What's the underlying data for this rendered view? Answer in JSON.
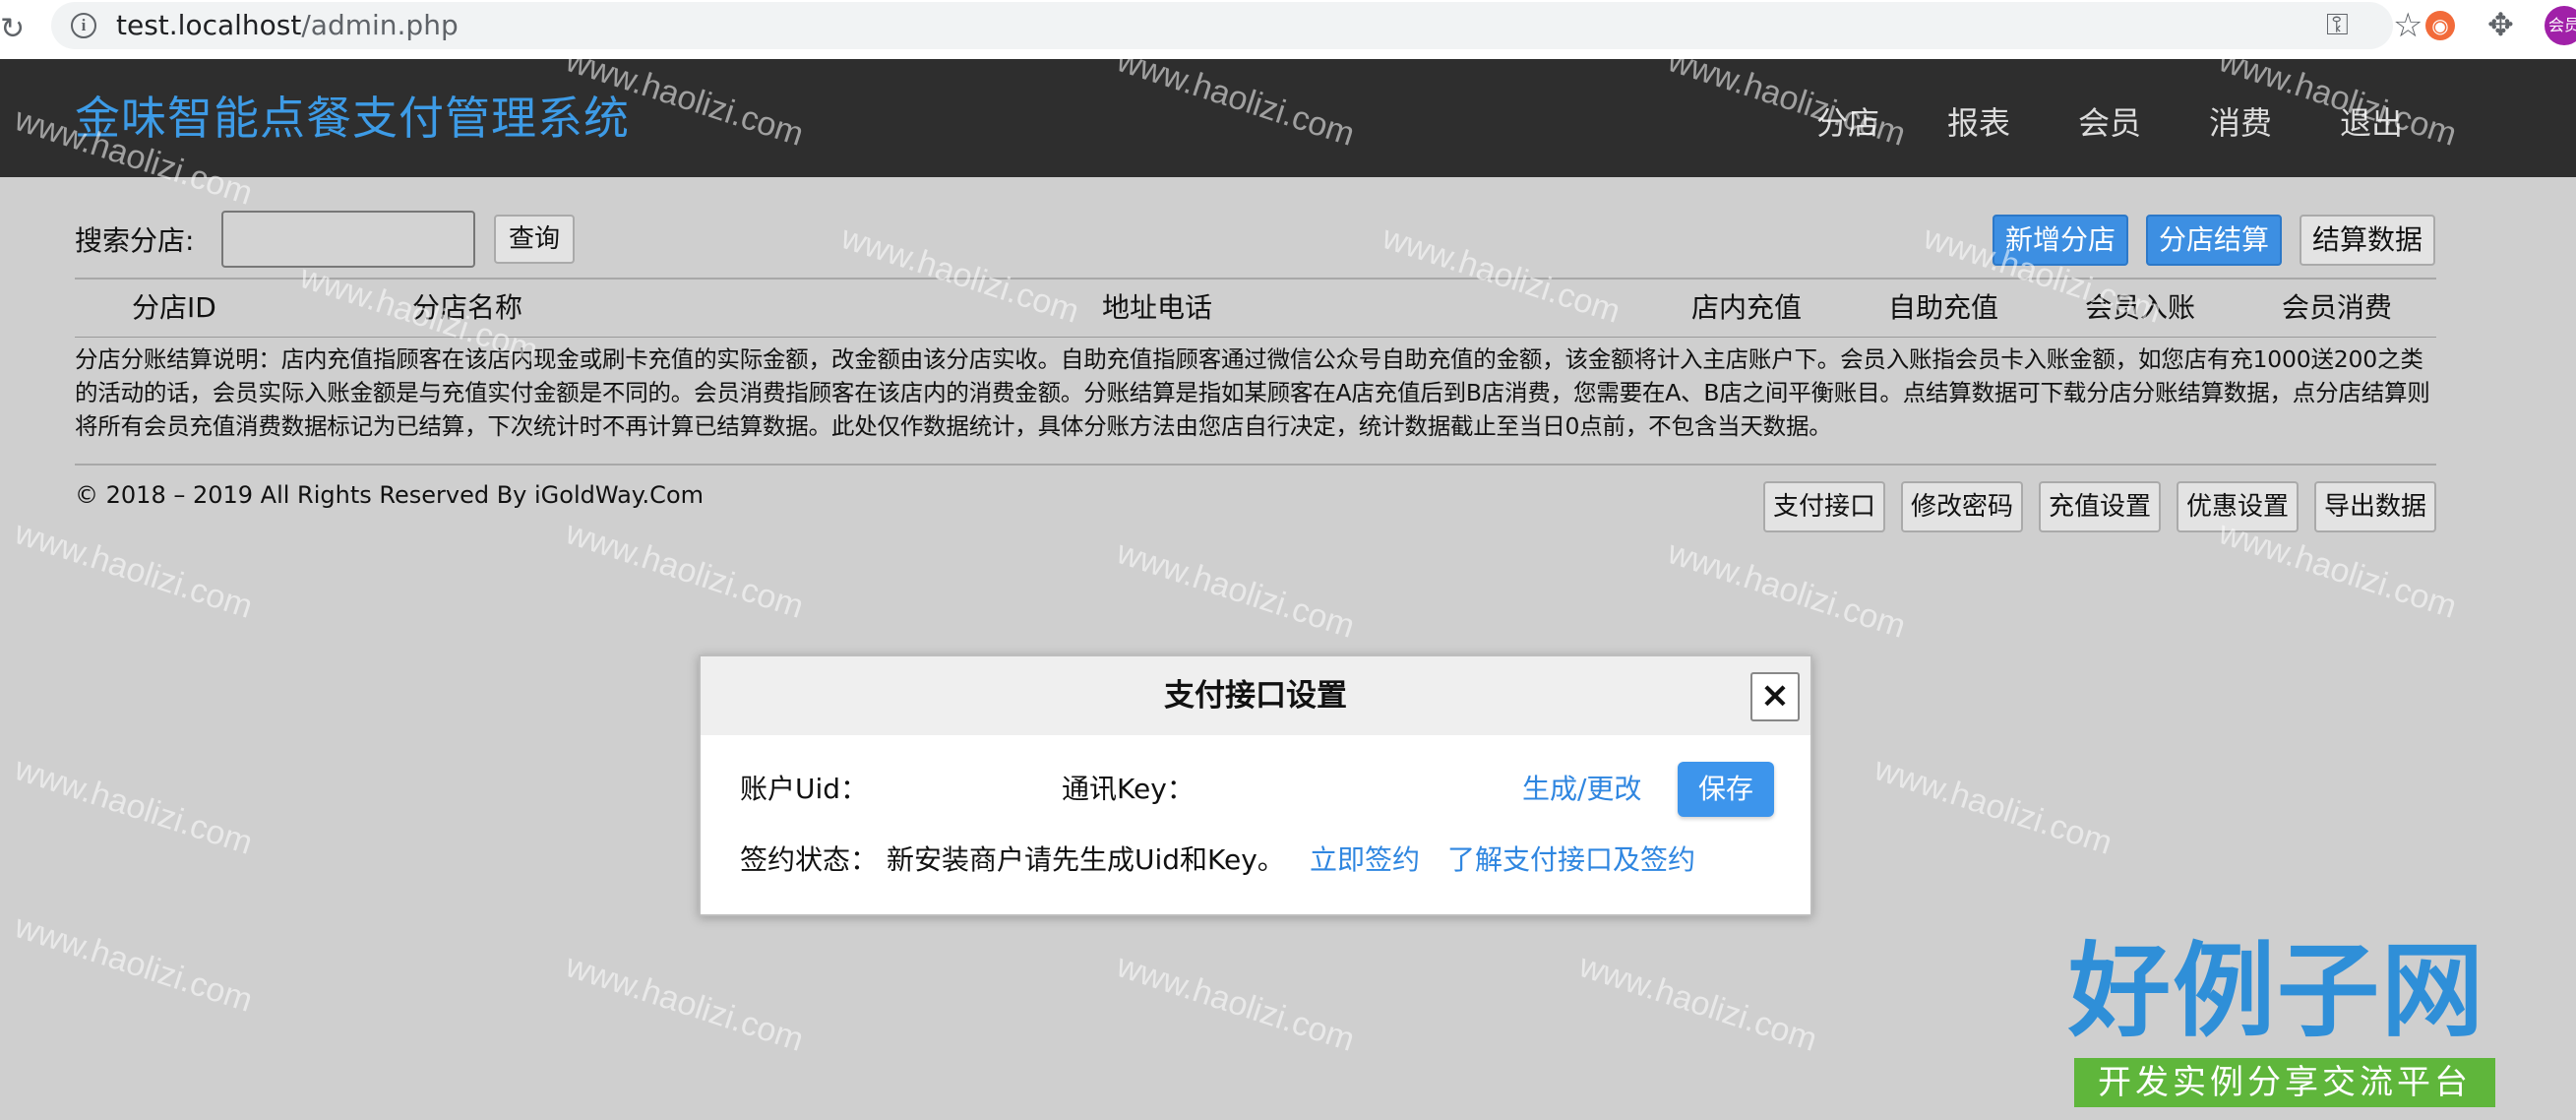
{
  "browser": {
    "url_host": "test.localhost",
    "url_path": "/admin.php",
    "profile_label": "会员"
  },
  "header": {
    "title": "金味智能点餐支付管理系统",
    "nav": [
      "分店",
      "报表",
      "会员",
      "消费",
      "退出"
    ]
  },
  "search": {
    "label": "搜索分店:",
    "input_value": "",
    "query_button": "查询",
    "buttons": [
      "新增分店",
      "分店结算",
      "结算数据"
    ]
  },
  "table": {
    "columns": [
      "分店ID",
      "分店名称",
      "地址电话",
      "店内充值",
      "自助充值",
      "会员入账",
      "会员消费"
    ],
    "rows": []
  },
  "note": "分店分账结算说明：店内充值指顾客在该店内现金或刷卡充值的实际金额，改金额由该分店实收。自助充值指顾客通过微信公众号自助充值的金额，该金额将计入主店账户下。会员入账指会员卡入账金额，如您店有充1000送200之类的活动的话，会员实际入账金额是与充值实付金额是不同的。会员消费指顾客在该店内的消费金额。分账结算是指如某顾客在A店充值后到B店消费，您需要在A、B店之间平衡账目。点结算数据可下载分店分账结算数据，点分店结算则将所有会员充值消费数据标记为已结算，下次统计时不再计算已结算数据。此处仅作数据统计，具体分账方法由您店自行决定，统计数据截止至当日0点前，不包含当天数据。",
  "footer": {
    "copyright": "© 2018 – 2019 All Rights Reserved By iGoldWay.Com",
    "buttons": [
      "支付接口",
      "修改密码",
      "充值设置",
      "优惠设置",
      "导出数据"
    ]
  },
  "modal": {
    "title": "支付接口设置",
    "close": "×",
    "uid_label": "账户Uid：",
    "uid_value": "",
    "key_label": "通讯Key：",
    "key_value": "",
    "generate_link": "生成/更改",
    "save_button": "保存",
    "status_label": "签约状态：",
    "status_value": "新安装商户请先生成Uid和Key。",
    "sign_link": "立即签约",
    "learn_link": "了解支付接口及签约"
  },
  "watermark": {
    "text": "www.haolizi.com",
    "logo": "好例子网",
    "logo_sub": "开发实例分享交流平台"
  }
}
